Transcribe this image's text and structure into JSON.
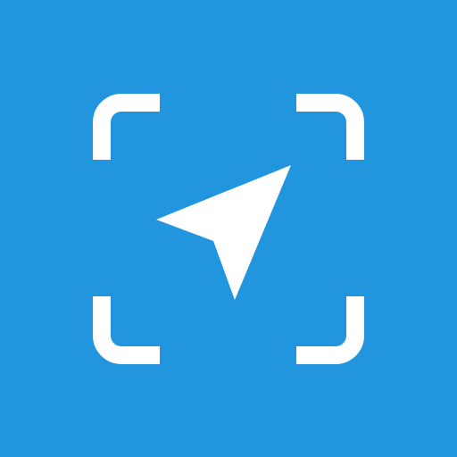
{
  "icon": {
    "name": "location-focus-icon",
    "colors": {
      "background": "#2196DF",
      "foreground": "#FFFFFF"
    },
    "parts": {
      "viewfinder": "viewfinder-corners-icon",
      "pointer": "navigation-arrow-icon"
    }
  }
}
